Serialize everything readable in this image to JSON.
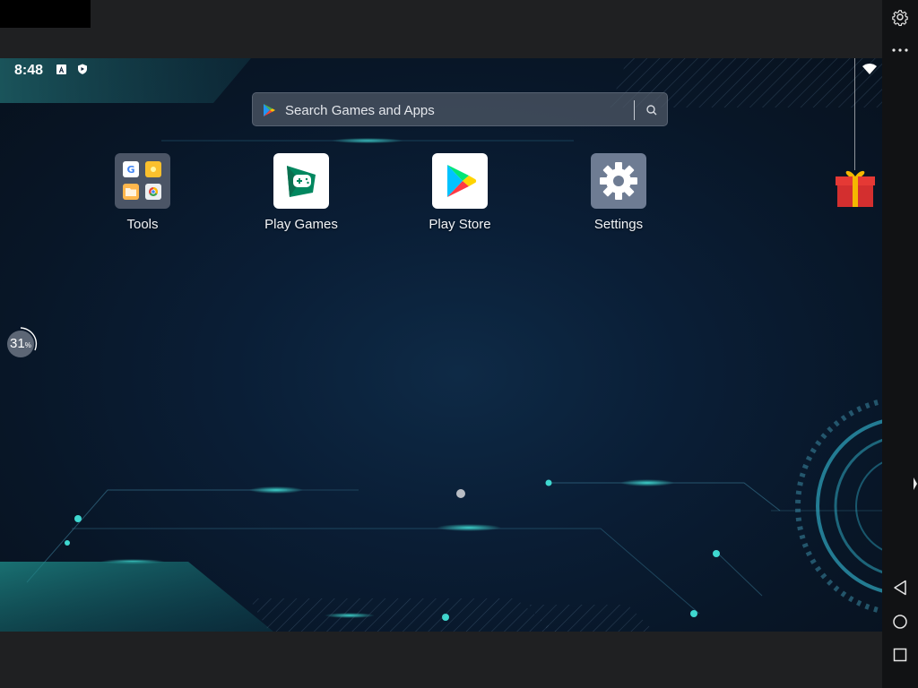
{
  "status_bar": {
    "time": "8:48",
    "icons": [
      "notification-a-icon",
      "shield-icon",
      "wifi-icon"
    ]
  },
  "search": {
    "placeholder": "Search Games and Apps",
    "icons": [
      "play-store-logo-icon",
      "search-icon"
    ]
  },
  "apps": [
    {
      "label": "Tools",
      "icon": "tools-folder-icon"
    },
    {
      "label": "Play Games",
      "icon": "play-games-icon"
    },
    {
      "label": "Play Store",
      "icon": "play-store-icon"
    },
    {
      "label": "Settings",
      "icon": "settings-gear-icon"
    }
  ],
  "progress_widget": {
    "value": "31",
    "unit": "%"
  },
  "home_pages": {
    "count": 1,
    "current": 1
  },
  "side_toolbar": {
    "icons": [
      "settings-icon",
      "more-icon",
      "back-icon",
      "home-icon",
      "recents-icon"
    ]
  },
  "colors": {
    "screen_bg": "#0a1e36",
    "accent_glow": "#2ad1c9",
    "gift_red": "#e53935",
    "ribbon_gold": "#f5b700"
  }
}
